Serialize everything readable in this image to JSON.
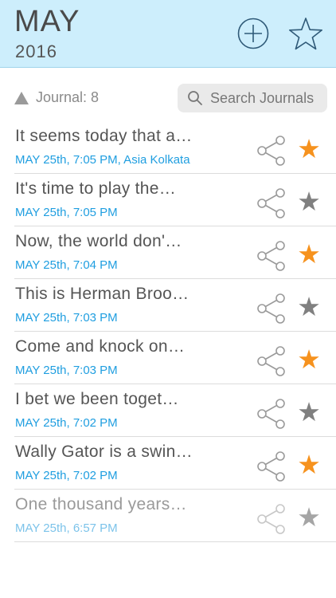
{
  "header": {
    "month": "MAY",
    "year": "2016",
    "add_icon": "plus-circle-icon",
    "favorites_icon": "star-outline-icon"
  },
  "toolbar": {
    "count_label": "Journal:",
    "count_value": "8",
    "search_placeholder": "Search Journals"
  },
  "colors": {
    "header_bg": "#cdeefc",
    "accent_blue": "#1f9ee0",
    "star_active": "#f6921e",
    "star_inactive": "#808080"
  },
  "journals": [
    {
      "title": "It seems today that a…",
      "date": "MAY 25th, 7:05 PM, Asia Kolkata",
      "starred": true
    },
    {
      "title": "It's time to play the…",
      "date": "MAY 25th, 7:05 PM",
      "starred": false
    },
    {
      "title": "Now, the world don'…",
      "date": "MAY 25th, 7:04 PM",
      "starred": true
    },
    {
      "title": "This is Herman Broo…",
      "date": "MAY 25th, 7:03 PM",
      "starred": false
    },
    {
      "title": "Come and knock on…",
      "date": "MAY 25th, 7:03 PM",
      "starred": true
    },
    {
      "title": "I bet we been toget…",
      "date": "MAY 25th, 7:02 PM",
      "starred": false
    },
    {
      "title": "Wally Gator is a swin…",
      "date": "MAY 25th, 7:02 PM",
      "starred": true
    },
    {
      "title": "One thousand years…",
      "date": "MAY 25th, 6:57 PM",
      "starred": false
    }
  ]
}
